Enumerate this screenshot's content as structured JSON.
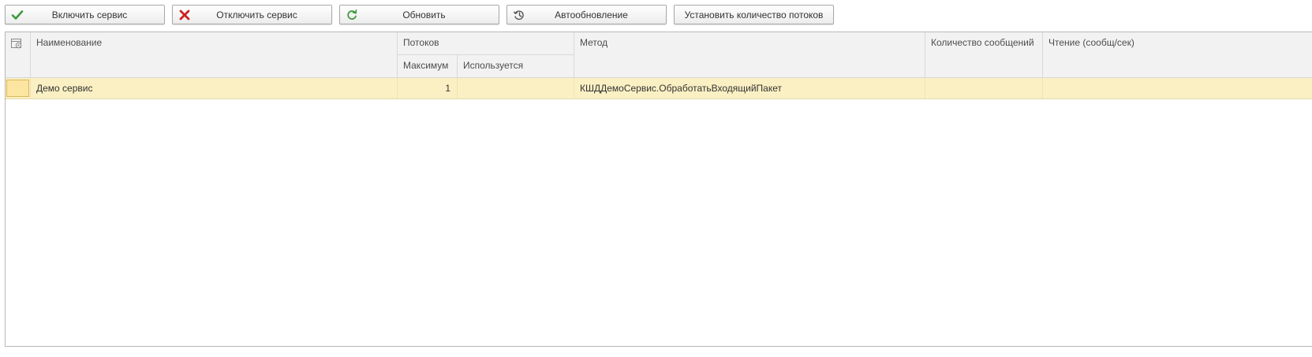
{
  "toolbar": {
    "enable_label": "Включить сервис",
    "disable_label": "Отключить сервис",
    "refresh_label": "Обновить",
    "autorefresh_label": "Автообновление",
    "set_threads_label": "Установить количество потоков"
  },
  "table": {
    "columns": {
      "name": "Наименование",
      "threads": "Потоков",
      "max": "Максимум",
      "used": "Используется",
      "method": "Метод",
      "messages": "Количество сообщений",
      "read_rate": "Чтение (сообщ/сек)"
    },
    "rows": [
      {
        "name": "Демо сервис",
        "max": "1",
        "used": "",
        "method": "КШДДемоСервис.ОбработатьВходящийПакет",
        "messages": "",
        "read_rate": ""
      }
    ]
  },
  "colors": {
    "selected_row": "#fbf0c3",
    "selected_cell": "#fce5a0",
    "header_bg": "#f2f2f2",
    "enable_icon": "#3d9a3d",
    "disable_icon": "#cc2222"
  },
  "icons": {
    "enable": "checkmark-icon",
    "disable": "x-icon",
    "refresh": "refresh-icon",
    "autorefresh": "history-clock-icon",
    "settings": "column-settings-icon"
  }
}
